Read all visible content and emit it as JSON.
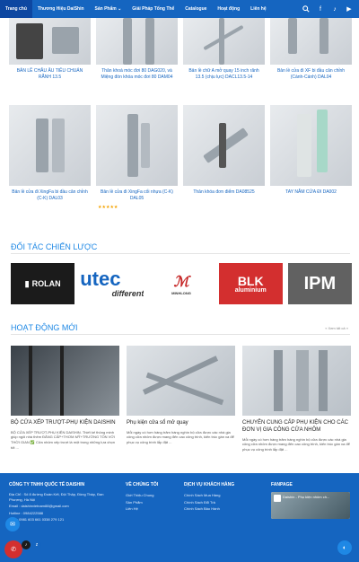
{
  "nav": {
    "items": [
      "Trang chủ",
      "Thương Hiệu DaiShin",
      "Sản Phẩm ⌄",
      "Giải Pháp Tổng Thể",
      "Catalogue",
      "Hoạt động",
      "Liên hệ"
    ],
    "icons": [
      "search-icon",
      "facebook-icon",
      "tiktok-icon",
      "youtube-icon"
    ]
  },
  "products_row1": [
    {
      "name": "BẢN LỀ CHÂU ÂU TIÊU CHUẨN RÃNH 13.5"
    },
    {
      "name": "Thân khoá móc đơi 80 DAG020, và Miệng đón khóa móc đơi 80 DAM04"
    },
    {
      "name": "Bản lề chữ A mở quay 15 inch rãnh 13.5 (chịu lực) DACL13.5-14"
    },
    {
      "name": "Bản lề cửa đi XF bi đầu cân chỉnh (Cánh-Cánh) DAL04"
    }
  ],
  "products_row2": [
    {
      "name": "Bản lề cửa đi XingFa bi đầu cân chỉnh (C-K) DAL03"
    },
    {
      "name": "Bản lề cửa đi XingFa cối nhựa (C-K) DAL05",
      "stars": "★★★★★"
    },
    {
      "name": "Thân khóa đơn điểm DA08525"
    },
    {
      "name": "TAY NẮM CỬA ĐI DA002"
    }
  ],
  "partners": {
    "title": "ĐỐI TÁC CHIẾN LƯỢC",
    "logos": [
      "ROLAN",
      "utec",
      "different",
      "MINHLONG",
      "BLK",
      "aluminium",
      "IPM"
    ]
  },
  "news": {
    "title": "HOẠT ĐỘNG MỚI",
    "see_all": "« Xem tất cả »",
    "items": [
      {
        "title": "BỘ CỬA XẾP TRƯỢT-PHỤ KIỆN DAISHIN",
        "desc": "BỘ CỬA XẾP TRƯỢT-PHỤ KIỆN DAISHIN. Thiết kế thông minh giúp ngôi nhà thêm ĐẲNG CẤP+THƠM MỸ+TRƯỜNG TỒN VỚI THỜI GIAN ✅ Cửa nhôm xếp trượt là một trong những lựa chọn tốt ..."
      },
      {
        "title": "Phụ kiện cửa sổ mở quay",
        "desc": "Mỗi ngày có hơn hàng trăm hàng nghìn bộ cửa được các nhà gia công cửa nhôm được mang đến cao công trình, kiến trúc gần xa để phục vụ công trình lắp đặt ..."
      },
      {
        "title": "CHUYÊN CUNG CẤP PHỤ KIỆN CHO CÁC ĐƠN VỊ GIA CÔNG CỬA NHÔM",
        "desc": "Mỗi ngày có hơn hàng trăm hàng nghìn bộ cửa được các nhà gia công cửa nhôm được mang đến cao công trình, kiến trúc gần xa để phục vụ công trình lắp đặt ..."
      }
    ]
  },
  "footer": {
    "company": {
      "title": "CÔNG TY TNHH QUỐC TẾ DAISHIN",
      "address": "Địa Chỉ : Số 8 đường Đoàn Kết, Đội Thập, Đồng Tháp, Đan Phượng, Hà Nội",
      "email": "Email : daishinvietnam88@gmail.com",
      "hotline": "Hotline : 0984222588",
      "zalo": "Zalo : 0981 603 661 0338 279 121"
    },
    "about": {
      "title": "VỀ CHÚNG TÔI",
      "links": [
        "Giới Thiệu Chung",
        "Sản Phẩm",
        "Liên Hệ"
      ]
    },
    "service": {
      "title": "DỊCH VỤ KHÁCH HÀNG",
      "links": [
        "Chính Sách Mua Hàng",
        "Chính Sách Đổi Trả",
        "Chính Sách Bảo Hành"
      ]
    },
    "fanpage": {
      "title": "FANPAGE",
      "page_name": "Daishin - Phụ kiện nhôm ch..."
    }
  },
  "colors": {
    "brand": "#1565c0",
    "accent": "#1e88e5",
    "star": "#f4a300"
  }
}
